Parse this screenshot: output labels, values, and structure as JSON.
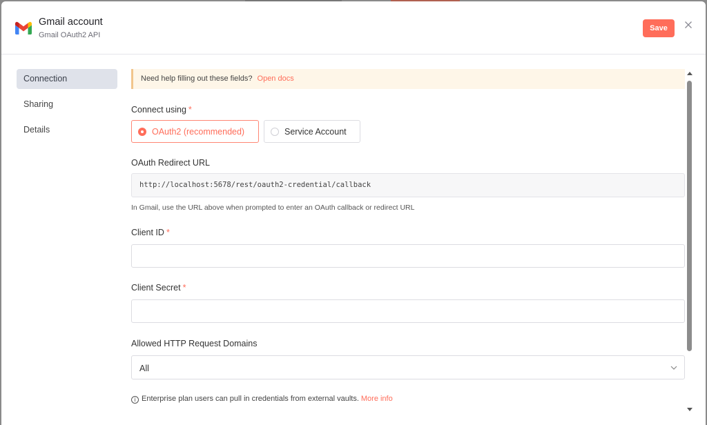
{
  "header": {
    "title": "Gmail account",
    "subtitle": "Gmail OAuth2 API",
    "save_label": "Save",
    "logo_icon": "gmail-logo-icon",
    "close_icon": "close-icon"
  },
  "sidebar": {
    "items": [
      {
        "label": "Connection",
        "active": true
      },
      {
        "label": "Sharing",
        "active": false
      },
      {
        "label": "Details",
        "active": false
      }
    ]
  },
  "content": {
    "help_text": "Need help filling out these fields?",
    "help_link": "Open docs",
    "connect_label": "Connect using",
    "required_mark": "*",
    "options": [
      {
        "label": "OAuth2 (recommended)",
        "selected": true
      },
      {
        "label": "Service Account",
        "selected": false
      }
    ],
    "redirect_label": "OAuth Redirect URL",
    "redirect_url": "http://localhost:5678/rest/oauth2-credential/callback",
    "redirect_hint": "In Gmail, use the URL above when prompted to enter an OAuth callback or redirect URL",
    "client_id_label": "Client ID",
    "client_id_value": "",
    "client_secret_label": "Client Secret",
    "client_secret_value": "",
    "domains_label": "Allowed HTTP Request Domains",
    "domains_value": "All",
    "info_text": "Enterprise plan users can pull in credentials from external vaults.",
    "info_link": "More info"
  },
  "colors": {
    "accent": "#ff6d5a",
    "banner_bg": "#fef6e8",
    "banner_border": "#f1c58c",
    "active_nav_bg": "#dfe2ea"
  }
}
